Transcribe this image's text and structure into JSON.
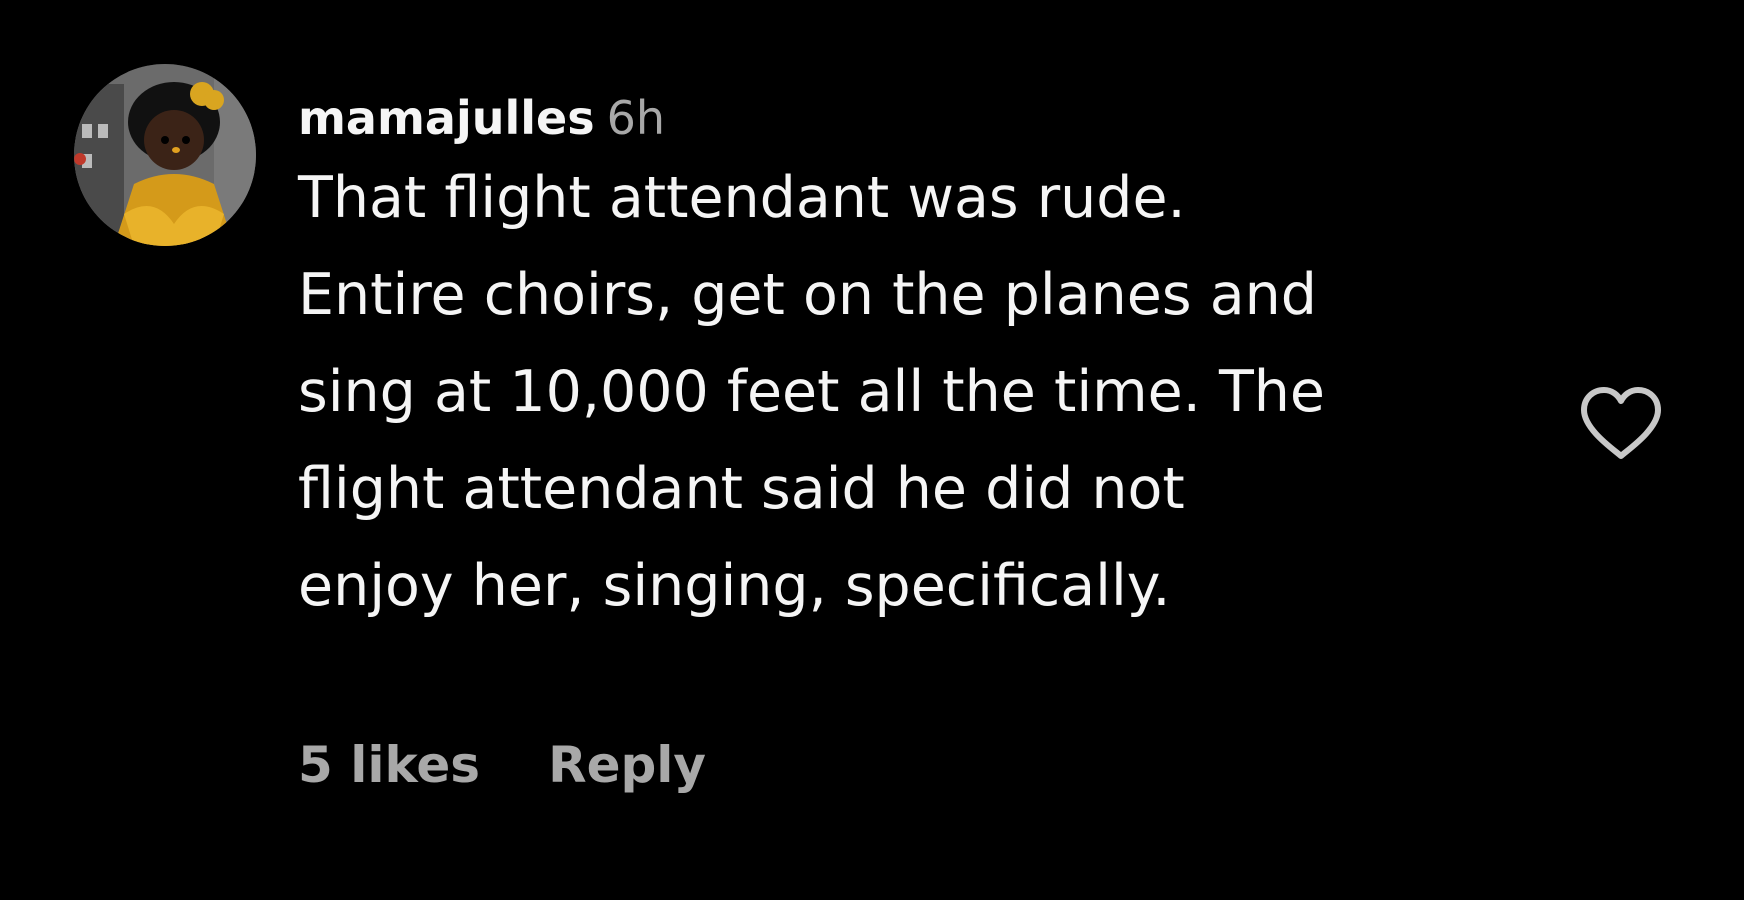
{
  "comment": {
    "username": "mamajulles",
    "time": "6h",
    "text_lines": [
      "That flight attendant was rude.",
      "Entire choirs, get on the planes and",
      "sing at 10,000 feet all the time. The",
      "flight attendant said he did not",
      "enjoy her, singing, specifically."
    ],
    "likes_label": "5 likes",
    "reply_label": "Reply"
  },
  "icons": {
    "like": "heart-outline-icon",
    "avatar": "user-avatar"
  },
  "colors": {
    "background": "#000000",
    "primary_text": "#f5f5f5",
    "secondary_text": "#a8a8a8",
    "icon": "#c8c8c8"
  }
}
